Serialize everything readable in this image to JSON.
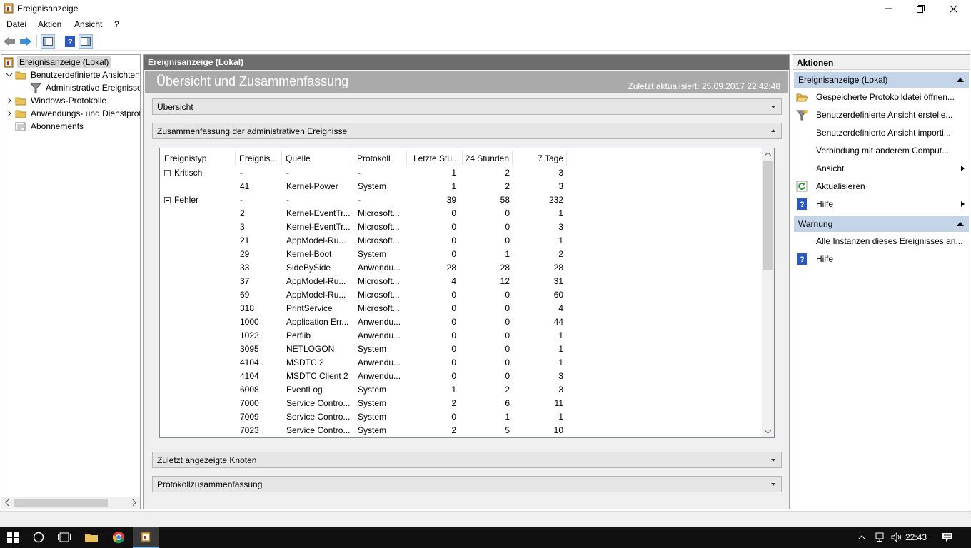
{
  "window": {
    "title": "Ereignisanzeige"
  },
  "menu": [
    "Datei",
    "Aktion",
    "Ansicht",
    "?"
  ],
  "tree": [
    {
      "label": "Ereignisanzeige (Lokal)",
      "indent": 0,
      "selected": true,
      "expander": ""
    },
    {
      "label": "Benutzerdefinierte Ansichten",
      "indent": 1,
      "expander": "v"
    },
    {
      "label": "Administrative Ereignisse",
      "indent": 2,
      "expander": ""
    },
    {
      "label": "Windows-Protokolle",
      "indent": 1,
      "expander": ">"
    },
    {
      "label": "Anwendungs- und Dienstprotokolle",
      "indent": 1,
      "expander": ">"
    },
    {
      "label": "Abonnements",
      "indent": 1,
      "expander": ""
    }
  ],
  "center": {
    "header": "Ereignisanzeige (Lokal)",
    "banner_title": "Übersicht und Zusammenfassung",
    "updated": "Zuletzt aktualisiert: 25.09.2017 22:42:48",
    "sections": {
      "overview": "Übersicht",
      "admin_summary": "Zusammenfassung der administrativen Ereignisse",
      "recent_nodes": "Zuletzt angezeigte Knoten",
      "log_summary": "Protokollzusammenfassung"
    }
  },
  "grid": {
    "columns": [
      "Ereignistyp",
      "Ereignis...",
      "Quelle",
      "Protokoll",
      "Letzte Stu...",
      "24 Stunden",
      "7 Tage"
    ],
    "rows": [
      {
        "type": "Kritisch",
        "group": true,
        "id": "-",
        "source": "-",
        "log": "-",
        "hour": "1",
        "day": "2",
        "week": "3"
      },
      {
        "type": "",
        "id": "41",
        "source": "Kernel-Power",
        "log": "System",
        "hour": "1",
        "day": "2",
        "week": "3"
      },
      {
        "type": "Fehler",
        "group": true,
        "id": "-",
        "source": "-",
        "log": "-",
        "hour": "39",
        "day": "58",
        "week": "232"
      },
      {
        "type": "",
        "id": "2",
        "source": "Kernel-EventTr...",
        "log": "Microsoft...",
        "hour": "0",
        "day": "0",
        "week": "1"
      },
      {
        "type": "",
        "id": "3",
        "source": "Kernel-EventTr...",
        "log": "Microsoft...",
        "hour": "0",
        "day": "0",
        "week": "3"
      },
      {
        "type": "",
        "id": "21",
        "source": "AppModel-Ru...",
        "log": "Microsoft...",
        "hour": "0",
        "day": "0",
        "week": "1"
      },
      {
        "type": "",
        "id": "29",
        "source": "Kernel-Boot",
        "log": "System",
        "hour": "0",
        "day": "1",
        "week": "2"
      },
      {
        "type": "",
        "id": "33",
        "source": "SideBySide",
        "log": "Anwendu...",
        "hour": "28",
        "day": "28",
        "week": "28"
      },
      {
        "type": "",
        "id": "37",
        "source": "AppModel-Ru...",
        "log": "Microsoft...",
        "hour": "4",
        "day": "12",
        "week": "31"
      },
      {
        "type": "",
        "id": "69",
        "source": "AppModel-Ru...",
        "log": "Microsoft...",
        "hour": "0",
        "day": "0",
        "week": "60"
      },
      {
        "type": "",
        "id": "318",
        "source": "PrintService",
        "log": "Microsoft...",
        "hour": "0",
        "day": "0",
        "week": "4"
      },
      {
        "type": "",
        "id": "1000",
        "source": "Application Err...",
        "log": "Anwendu...",
        "hour": "0",
        "day": "0",
        "week": "44"
      },
      {
        "type": "",
        "id": "1023",
        "source": "Perflib",
        "log": "Anwendu...",
        "hour": "0",
        "day": "0",
        "week": "1"
      },
      {
        "type": "",
        "id": "3095",
        "source": "NETLOGON",
        "log": "System",
        "hour": "0",
        "day": "0",
        "week": "1"
      },
      {
        "type": "",
        "id": "4104",
        "source": "MSDTC 2",
        "log": "Anwendu...",
        "hour": "0",
        "day": "0",
        "week": "1"
      },
      {
        "type": "",
        "id": "4104",
        "source": "MSDTC Client 2",
        "log": "Anwendu...",
        "hour": "0",
        "day": "0",
        "week": "3"
      },
      {
        "type": "",
        "id": "6008",
        "source": "EventLog",
        "log": "System",
        "hour": "1",
        "day": "2",
        "week": "3"
      },
      {
        "type": "",
        "id": "7000",
        "source": "Service Contro...",
        "log": "System",
        "hour": "2",
        "day": "6",
        "week": "11"
      },
      {
        "type": "",
        "id": "7009",
        "source": "Service Contro...",
        "log": "System",
        "hour": "0",
        "day": "1",
        "week": "1"
      },
      {
        "type": "",
        "id": "7023",
        "source": "Service Contro...",
        "log": "System",
        "hour": "2",
        "day": "5",
        "week": "10"
      }
    ]
  },
  "actions": {
    "title": "Aktionen",
    "group1": "Ereignisanzeige (Lokal)",
    "items1": [
      {
        "label": "Gespeicherte Protokolldatei öffnen...",
        "icon": "folder-open-icon",
        "submenu": false
      },
      {
        "label": "Benutzerdefinierte Ansicht erstelle...",
        "icon": "filter-icon",
        "submenu": false
      },
      {
        "label": "Benutzerdefinierte Ansicht importi...",
        "icon": "",
        "submenu": false
      },
      {
        "label": "Verbindung mit anderem Comput...",
        "icon": "",
        "submenu": false
      },
      {
        "label": "Ansicht",
        "icon": "",
        "submenu": true
      },
      {
        "label": "Aktualisieren",
        "icon": "refresh-icon",
        "submenu": false
      },
      {
        "label": "Hilfe",
        "icon": "help-icon",
        "submenu": true
      }
    ],
    "group2": "Warnung",
    "items2": [
      {
        "label": "Alle Instanzen dieses Ereignisses an...",
        "icon": "",
        "submenu": false
      },
      {
        "label": "Hilfe",
        "icon": "help-icon",
        "submenu": false
      }
    ]
  },
  "taskbar": {
    "clock": "22:43"
  },
  "colors": {
    "accent_group": "#c5d5e9",
    "center_header": "#6d6d6d",
    "banner": "#aaaaaa"
  }
}
